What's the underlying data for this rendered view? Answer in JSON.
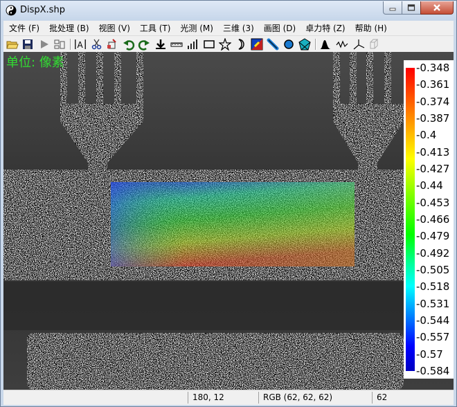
{
  "window": {
    "title": "DispX.shp",
    "minimize_icon": "minimize-icon",
    "maximize_icon": "maximize-icon",
    "close_icon": "close-icon"
  },
  "menu": [
    {
      "label": "文件 (F)"
    },
    {
      "label": "批处理 (B)"
    },
    {
      "label": "视图 (V)"
    },
    {
      "label": "工具 (T)"
    },
    {
      "label": "光测 (M)"
    },
    {
      "label": "三维 (3)"
    },
    {
      "label": "画图 (D)"
    },
    {
      "label": "卓力特 (Z)"
    },
    {
      "label": "帮助 (H)"
    }
  ],
  "toolbar_icons": [
    "open-folder-icon",
    "save-icon",
    "play-icon",
    "layout-icon",
    "text-icon",
    "cut-icon",
    "crop-icon",
    "undo-icon",
    "redo-icon",
    "download-icon",
    "ruler-icon",
    "bar-chart-icon",
    "rectangle-icon",
    "star-icon",
    "moon-icon",
    "colormap-icon",
    "line-icon",
    "circle-icon",
    "polygon-icon",
    "histogram-icon",
    "wave-icon",
    "axes-icon",
    "cube-icon"
  ],
  "canvas": {
    "unit_label": "单位: 像素"
  },
  "colorbar": {
    "labels": [
      "-0.348",
      "-0.361",
      "-0.374",
      "-0.387",
      "-0.4",
      "-0.413",
      "-0.427",
      "-0.44",
      "-0.453",
      "-0.466",
      "-0.479",
      "-0.492",
      "-0.505",
      "-0.518",
      "-0.531",
      "-0.544",
      "-0.557",
      "-0.57",
      "-0.584"
    ],
    "colors": [
      "#ff0000",
      "#ff8000",
      "#ffff00",
      "#80ff00",
      "#00ff00",
      "#00ffa0",
      "#00ffff",
      "#0080ff",
      "#0000ff",
      "#0000c0"
    ]
  },
  "statusbar": {
    "coords": "180, 12",
    "rgb": "RGB (62, 62, 62)",
    "value": "62"
  }
}
